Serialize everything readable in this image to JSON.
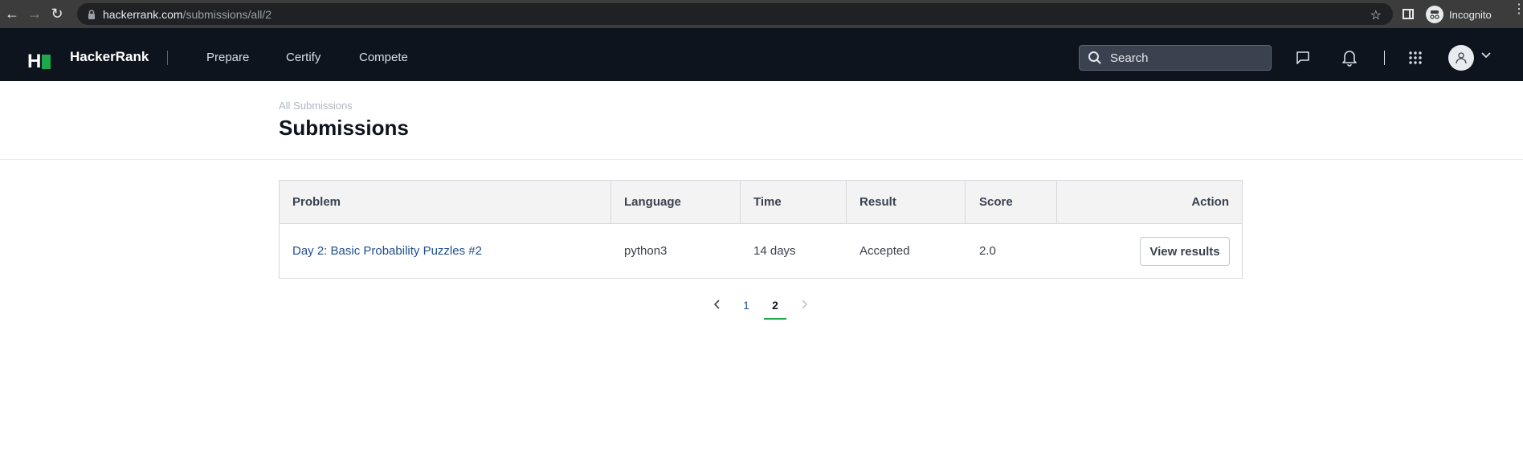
{
  "browser": {
    "url_host": "hackerrank.com",
    "url_path": "/submissions/all/2",
    "incognito_label": "Incognito"
  },
  "nav": {
    "brand": "HackerRank",
    "links": [
      "Prepare",
      "Certify",
      "Compete"
    ],
    "search_placeholder": "Search"
  },
  "header": {
    "breadcrumb": "All Submissions",
    "title": "Submissions"
  },
  "table": {
    "columns": [
      "Problem",
      "Language",
      "Time",
      "Result",
      "Score",
      "Action"
    ],
    "rows": [
      {
        "problem": "Day 2: Basic Probability Puzzles #2",
        "language": "python3",
        "time": "14 days",
        "result": "Accepted",
        "score": "2.0",
        "action": "View results"
      }
    ]
  },
  "pagination": {
    "pages": [
      "1",
      "2"
    ],
    "current": "2"
  },
  "colors": {
    "nav_bg": "#0e141e",
    "accent_green": "#1ba94c",
    "link_blue": "#1f4e8c"
  }
}
